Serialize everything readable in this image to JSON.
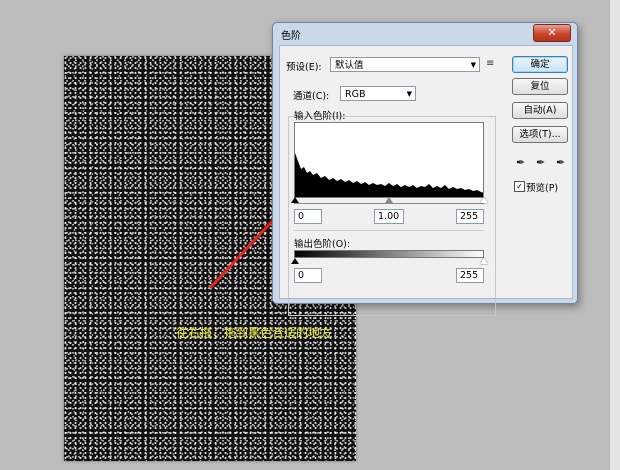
{
  "dialog": {
    "title": "色阶",
    "close_label": "✕",
    "preset_label": "预设(E):",
    "preset_value": "默认值",
    "preset_menu_icon": "menu-list-icon",
    "channel_label": "通道(C):",
    "channel_value": "RGB",
    "input_levels_label": "输入色阶(I):",
    "input_black": "0",
    "input_gamma": "1.00",
    "input_white": "255",
    "output_levels_label": "输出色阶(O):",
    "output_black": "0",
    "output_white": "255",
    "buttons": {
      "ok": "确定",
      "reset": "复位",
      "auto": "自动(A)",
      "options": "选项(T)..."
    },
    "preview_label": "预览(P)",
    "preview_checked": true
  },
  "annotation": {
    "caption": "往右拖，拖到黑色合适的地方"
  },
  "colors": {
    "caption": "#e9e92c",
    "arrow": "#e3261c",
    "dialog_frame": "#c9d9ea"
  }
}
